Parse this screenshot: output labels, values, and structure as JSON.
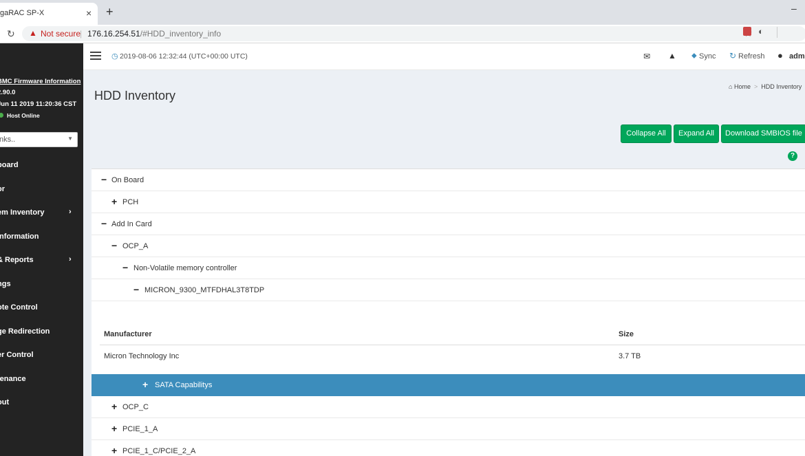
{
  "browser": {
    "tab_title": "gaRAC SP-X",
    "tab_close": "×",
    "new_tab": "+",
    "window_min": "–",
    "not_secure": "Not secure",
    "url_host": "176.16.254.51",
    "url_path": "/#HDD_inventory_info",
    "icons": [
      "reload-icon",
      "warning-icon",
      "star-icon",
      "extension-icon",
      "circle-icon"
    ]
  },
  "sidebar": {
    "fw_title": "BMC Firmware Information",
    "fw_version": "2.90.0",
    "fw_date": "Jun 11 2019 11:20:36 CST",
    "host_status": "Host Online",
    "host_status_color": "#4cae4c",
    "quick_links_placeholder": "nks..",
    "items": [
      {
        "label": "board",
        "has_submenu": false
      },
      {
        "label": "or",
        "has_submenu": false
      },
      {
        "label": "em Inventory",
        "has_submenu": true
      },
      {
        "label": "Information",
        "has_submenu": false
      },
      {
        "label": "& Reports",
        "has_submenu": true
      },
      {
        "label": "ngs",
        "has_submenu": false
      },
      {
        "label": "ote Control",
        "has_submenu": false
      },
      {
        "label": "ge Redirection",
        "has_submenu": false
      },
      {
        "label": "er Control",
        "has_submenu": false
      },
      {
        "label": "tenance",
        "has_submenu": false
      },
      {
        "label": "out",
        "has_submenu": false
      }
    ]
  },
  "header": {
    "datetime": "2019-08-06 12:32:44 (UTC+00:00 UTC)",
    "sync_label": "Sync",
    "refresh_label": "Refresh",
    "user_label": "adm"
  },
  "page": {
    "title": "HDD Inventory",
    "breadcrumb": {
      "home": "Home",
      "current": "HDD Inventory"
    },
    "buttons": {
      "collapse_all": "Collapse All",
      "expand_all": "Expand All",
      "download_smbios": "Download SMBIOS file"
    },
    "help": "?",
    "accent_color": "#00a65a",
    "selected_color": "#3c8dbc"
  },
  "tree": [
    {
      "label": "On Board",
      "expanded": true,
      "depth": 0
    },
    {
      "label": "PCH",
      "expanded": false,
      "depth": 1
    },
    {
      "label": "Add In Card",
      "expanded": true,
      "depth": 0
    },
    {
      "label": "OCP_A",
      "expanded": true,
      "depth": 1
    },
    {
      "label": "Non-Volatile memory controller",
      "expanded": true,
      "depth": 2
    },
    {
      "label": "MICRON_9300_MTFDHAL3T8TDP",
      "expanded": true,
      "depth": 3
    }
  ],
  "details": {
    "headers": [
      "Manufacturer",
      "Size"
    ],
    "rows": [
      [
        "Micron Technology Inc",
        "3.7 TB"
      ]
    ]
  },
  "tree_after": [
    {
      "label": "SATA Capabilitys",
      "expanded": false,
      "depth": 4,
      "selected": true
    },
    {
      "label": "OCP_C",
      "expanded": false,
      "depth": 1
    },
    {
      "label": "PCIE_1_A",
      "expanded": false,
      "depth": 1
    },
    {
      "label": "PCIE_1_C/PCIE_2_A",
      "expanded": false,
      "depth": 1
    }
  ]
}
